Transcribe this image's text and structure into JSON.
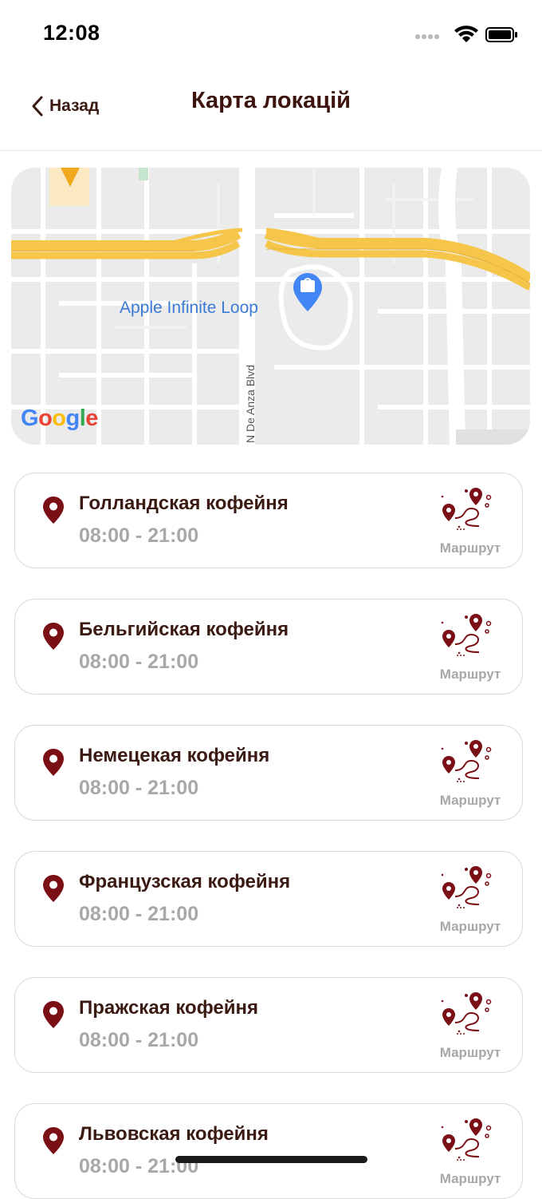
{
  "status": {
    "time": "12:08"
  },
  "nav": {
    "back_label": "Назад",
    "title": "Карта локацій"
  },
  "map": {
    "poi_label": "Apple Infinite Loop",
    "street_label": "N De Anza Blvd",
    "logo": {
      "G": "G",
      "o1": "o",
      "o2": "o",
      "g": "g",
      "l": "l",
      "e": "e"
    }
  },
  "locations": [
    {
      "name": "Голландская кофейня",
      "hours": "08:00 - 21:00",
      "route_label": "Маршрут"
    },
    {
      "name": "Бельгийская кофейня",
      "hours": "08:00 - 21:00",
      "route_label": "Маршрут"
    },
    {
      "name": "Немецекая кофейня",
      "hours": "08:00 - 21:00",
      "route_label": "Маршрут"
    },
    {
      "name": "Французская кофейня",
      "hours": "08:00 - 21:00",
      "route_label": "Маршрут"
    },
    {
      "name": "Пражская кофейня",
      "hours": "08:00 - 21:00",
      "route_label": "Маршрут"
    },
    {
      "name": "Львовская кофейня",
      "hours": "08:00 - 21:00",
      "route_label": "Маршрут"
    }
  ],
  "colors": {
    "accent": "#7a1015",
    "title": "#3d140d",
    "muted": "#a8a8a8",
    "highway": "#f5c64a"
  }
}
